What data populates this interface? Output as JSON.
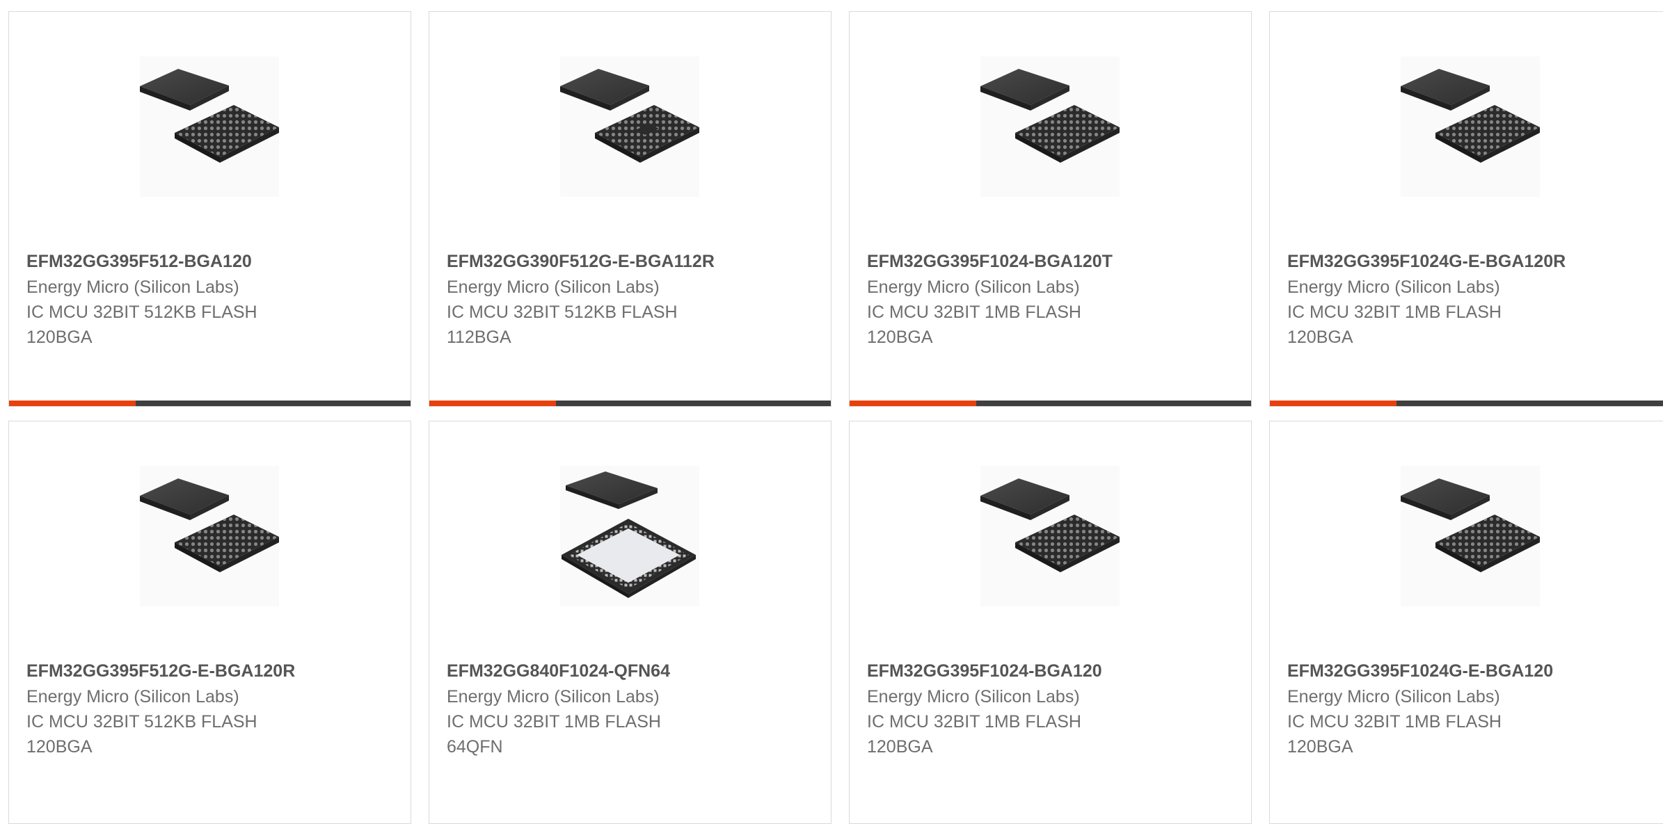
{
  "colors": {
    "accent": "#e8400c",
    "bar": "#3f3f3f",
    "border": "#d9d9d9"
  },
  "products": [
    {
      "name": "EFM32GG395F512-BGA120",
      "manufacturer": "Energy Micro (Silicon Labs)",
      "description": "IC MCU 32BIT 512KB FLASH",
      "package": "120BGA",
      "image_icon": "bga-chip-icon"
    },
    {
      "name": "EFM32GG390F512G-E-BGA112R",
      "manufacturer": "Energy Micro (Silicon Labs)",
      "description": "IC MCU 32BIT 512KB FLASH",
      "package": "112BGA",
      "image_icon": "bga-chip-icon"
    },
    {
      "name": "EFM32GG395F1024-BGA120T",
      "manufacturer": "Energy Micro (Silicon Labs)",
      "description": "IC MCU 32BIT 1MB FLASH",
      "package": "120BGA",
      "image_icon": "bga-chip-icon"
    },
    {
      "name": "EFM32GG395F1024G-E-BGA120R",
      "manufacturer": "Energy Micro (Silicon Labs)",
      "description": "IC MCU 32BIT 1MB FLASH",
      "package": "120BGA",
      "image_icon": "bga-chip-icon"
    },
    {
      "name": "EFM32GG395F512G-E-BGA120R",
      "manufacturer": "Energy Micro (Silicon Labs)",
      "description": "IC MCU 32BIT 512KB FLASH",
      "package": "120BGA",
      "image_icon": "bga-chip-icon"
    },
    {
      "name": "EFM32GG840F1024-QFN64",
      "manufacturer": "Energy Micro (Silicon Labs)",
      "description": "IC MCU 32BIT 1MB FLASH",
      "package": "64QFN",
      "image_icon": "qfn-chip-icon"
    },
    {
      "name": "EFM32GG395F1024-BGA120",
      "manufacturer": "Energy Micro (Silicon Labs)",
      "description": "IC MCU 32BIT 1MB FLASH",
      "package": "120BGA",
      "image_icon": "bga-chip-icon"
    },
    {
      "name": "EFM32GG395F1024G-E-BGA120",
      "manufacturer": "Energy Micro (Silicon Labs)",
      "description": "IC MCU 32BIT 1MB FLASH",
      "package": "120BGA",
      "image_icon": "bga-chip-icon"
    }
  ]
}
